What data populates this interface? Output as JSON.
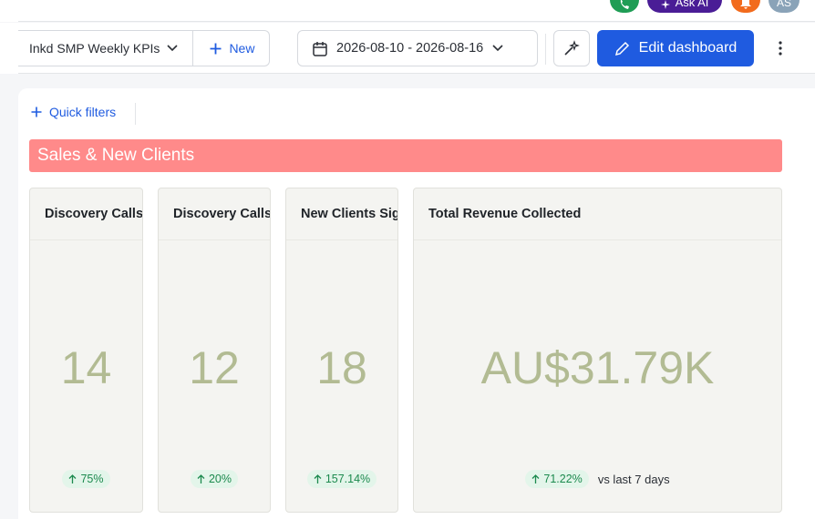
{
  "header": {
    "ask_ai_label": "Ask AI",
    "avatar_initials": "AS",
    "icons": [
      "phone-icon",
      "sparkle-icon",
      "bell-icon"
    ]
  },
  "toolbar": {
    "dashboard_name": "Inkd SMP Weekly KPIs",
    "new_label": "New",
    "date_range": "2026-08-10 - 2026-08-16",
    "edit_label": "Edit dashboard"
  },
  "filters": {
    "quick_filters_label": "Quick filters"
  },
  "section": {
    "title": "Sales & New Clients",
    "color": "#ff8a8a"
  },
  "cards": [
    {
      "title": "Discovery Calls Booked",
      "value": "14",
      "change": "75%",
      "direction": "up"
    },
    {
      "title": "Discovery Calls Held",
      "value": "12",
      "change": "20%",
      "direction": "up"
    },
    {
      "title": "New Clients Signed",
      "value": "18",
      "change": "157.14%",
      "direction": "up"
    },
    {
      "title": "Total Revenue Collected",
      "value": "AU$31.79K",
      "change": "71.22%",
      "direction": "up",
      "comparison": "vs last 7 days"
    }
  ],
  "colors": {
    "accent": "#1f5be0",
    "kpi_value": "#b2bb93",
    "positive_badge_bg": "#e3f5ea",
    "positive_badge_text": "#1c8a4e"
  }
}
